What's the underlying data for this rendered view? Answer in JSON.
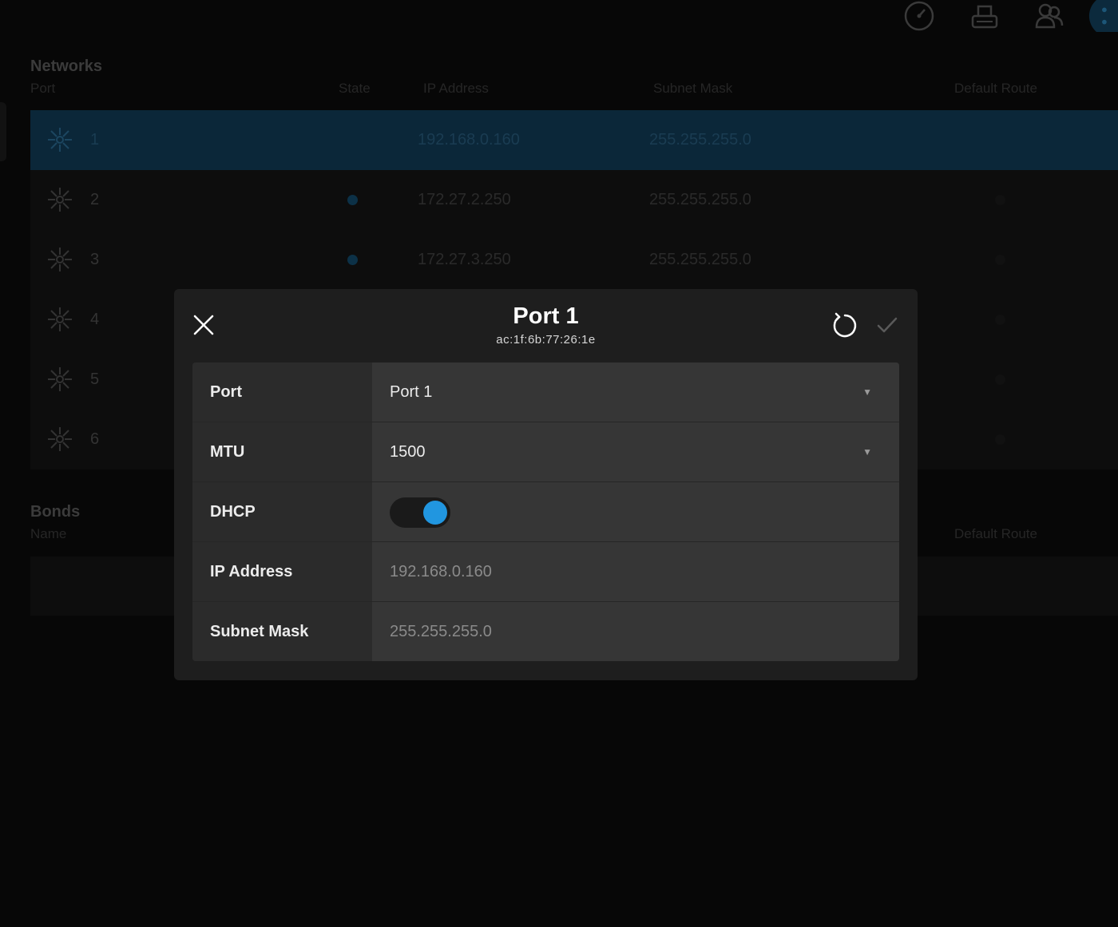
{
  "header": {
    "icons": [
      "dashboard-gauge-icon",
      "storage-drive-icon",
      "users-icon",
      "network-icon"
    ]
  },
  "networks": {
    "title": "Networks",
    "columns": {
      "port": "Port",
      "state": "State",
      "ip": "IP Address",
      "mask": "Subnet Mask",
      "route": "Default Route"
    },
    "rows": [
      {
        "num": "1",
        "ip": "192.168.0.160",
        "mask": "255.255.255.0",
        "selected": true
      },
      {
        "num": "2",
        "ip": "172.27.2.250",
        "mask": "255.255.255.0"
      },
      {
        "num": "3",
        "ip": "172.27.3.250",
        "mask": "255.255.255.0"
      },
      {
        "num": "4",
        "ip": "",
        "mask": ""
      },
      {
        "num": "5",
        "ip": "",
        "mask": ""
      },
      {
        "num": "6",
        "ip": "",
        "mask": ""
      }
    ]
  },
  "bonds": {
    "title": "Bonds",
    "columns": {
      "name": "Name",
      "route": "Default Route"
    }
  },
  "modal": {
    "title": "Port 1",
    "subtitle": "ac:1f:6b:77:26:1e",
    "fields": {
      "port": {
        "label": "Port",
        "value": "Port 1"
      },
      "mtu": {
        "label": "MTU",
        "value": "1500"
      },
      "dhcp": {
        "label": "DHCP",
        "enabled": true
      },
      "ip": {
        "label": "IP Address",
        "value": "192.168.0.160"
      },
      "mask": {
        "label": "Subnet Mask",
        "value": "255.255.255.0"
      }
    }
  },
  "colors": {
    "accent": "#2196e0",
    "selected_row": "#0b2739",
    "modal_bg": "#1e1e1e"
  }
}
